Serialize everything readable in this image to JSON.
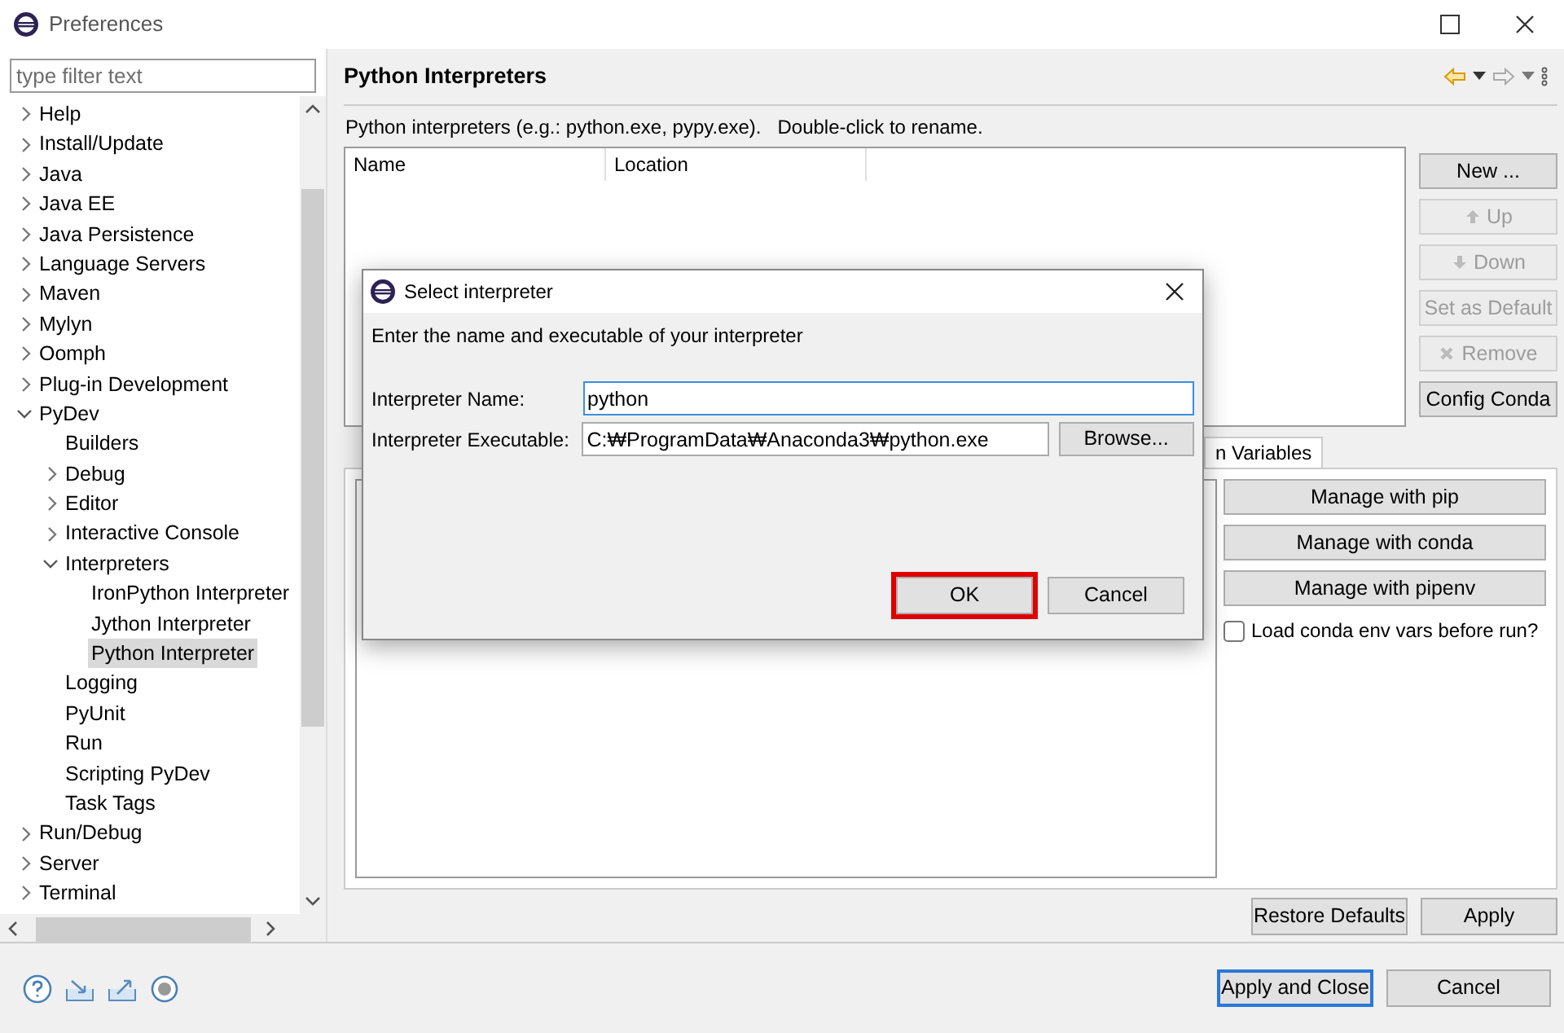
{
  "window": {
    "title": "Preferences"
  },
  "filter": {
    "placeholder": "type filter text"
  },
  "tree": [
    {
      "label": "Help",
      "expanded": false,
      "selected": false
    },
    {
      "label": "Install/Update",
      "expanded": false,
      "selected": false
    },
    {
      "label": "Java",
      "expanded": false,
      "selected": false
    },
    {
      "label": "Java EE",
      "expanded": false,
      "selected": false
    },
    {
      "label": "Java Persistence",
      "expanded": false,
      "selected": false
    },
    {
      "label": "Language Servers",
      "expanded": false,
      "selected": false
    },
    {
      "label": "Maven",
      "expanded": false,
      "selected": false
    },
    {
      "label": "Mylyn",
      "expanded": false,
      "selected": false
    },
    {
      "label": "Oomph",
      "expanded": false,
      "selected": false
    },
    {
      "label": "Plug-in Development",
      "expanded": false,
      "selected": false
    },
    {
      "label": "PyDev",
      "expanded": true,
      "selected": false,
      "children": [
        {
          "label": "Builders",
          "selected": false
        },
        {
          "label": "Debug",
          "expanded": false,
          "selected": false
        },
        {
          "label": "Editor",
          "expanded": false,
          "selected": false
        },
        {
          "label": "Interactive Console",
          "expanded": false,
          "selected": false
        },
        {
          "label": "Interpreters",
          "expanded": true,
          "selected": false,
          "children": [
            {
              "label": "IronPython Interpreter",
              "selected": false
            },
            {
              "label": "Jython Interpreter",
              "selected": false
            },
            {
              "label": "Python Interpreter",
              "selected": true
            }
          ]
        },
        {
          "label": "Logging",
          "selected": false
        },
        {
          "label": "PyUnit",
          "selected": false
        },
        {
          "label": "Run",
          "selected": false
        },
        {
          "label": "Scripting PyDev",
          "selected": false
        },
        {
          "label": "Task Tags",
          "selected": false
        }
      ]
    },
    {
      "label": "Run/Debug",
      "expanded": false,
      "selected": false
    },
    {
      "label": "Server",
      "expanded": false,
      "selected": false
    },
    {
      "label": "Terminal",
      "expanded": false,
      "selected": false
    }
  ],
  "page": {
    "title": "Python Interpreters",
    "description": "Python interpreters (e.g.: python.exe, pypy.exe).   Double-click to rename.",
    "table": {
      "columns": [
        "Name",
        "Location"
      ]
    },
    "side_buttons": [
      {
        "label": "New ...",
        "kind": "plain",
        "disabled": false
      },
      {
        "label": "Up",
        "kind": "up",
        "disabled": true
      },
      {
        "label": "Down",
        "kind": "down",
        "disabled": true
      },
      {
        "label": "Set as Default",
        "kind": "plain",
        "disabled": true
      },
      {
        "label": "Remove",
        "kind": "remove",
        "disabled": true
      },
      {
        "label": "Config Conda",
        "kind": "plain",
        "disabled": false
      }
    ],
    "tab": {
      "label": "n Variables"
    },
    "manage_buttons": [
      "Manage with pip",
      "Manage with conda",
      "Manage with pipenv"
    ],
    "checkbox": {
      "label": "Load conda env vars before run?",
      "checked": false
    },
    "buttons": [
      "Restore Defaults",
      "Apply"
    ]
  },
  "footer": {
    "buttons": [
      {
        "label": "Apply and Close",
        "default": true
      },
      {
        "label": "Cancel",
        "default": false
      }
    ]
  },
  "dialog": {
    "title": "Select interpreter",
    "message": "Enter the name and executable of your interpreter",
    "name_label": "Interpreter Name:",
    "name_value": "python",
    "name_focused": true,
    "exe_label": "Interpreter Executable:",
    "exe_value": "C:₩ProgramData₩Anaconda3₩python.exe",
    "browse": "Browse...",
    "buttons": [
      {
        "label": "OK",
        "highlighted": true
      },
      {
        "label": "Cancel",
        "highlighted": false
      }
    ]
  }
}
